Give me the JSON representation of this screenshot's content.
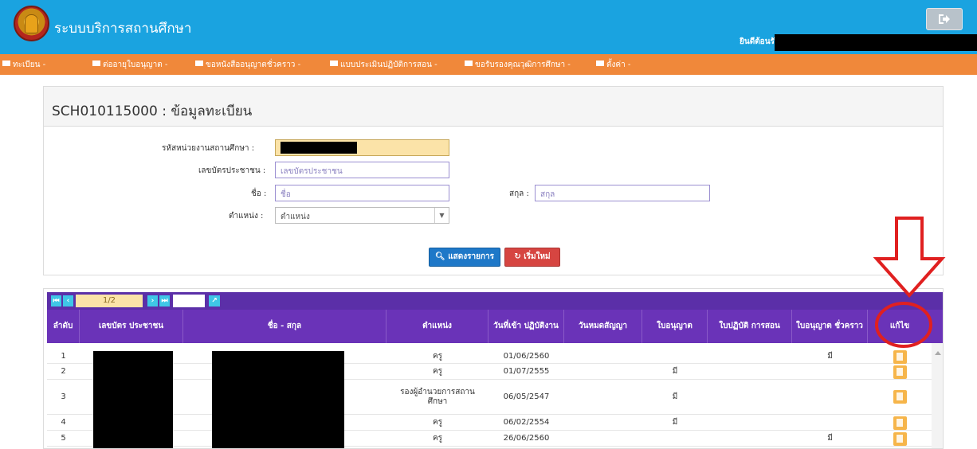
{
  "header": {
    "app_title": "ระบบบริการสถานศึกษา",
    "welcome": "ยินดีต้อนรับ",
    "logout_icon": "sign-out-icon"
  },
  "nav": {
    "items": [
      {
        "label": "ทะเบียน -"
      },
      {
        "label": "ต่ออายุใบอนุญาต -"
      },
      {
        "label": "ขอหนังสืออนุญาตชั่วคราว -"
      },
      {
        "label": "แบบประเมินปฏิบัติการสอน -"
      },
      {
        "label": "ขอรับรองคุณวุฒิการศึกษา -"
      },
      {
        "label": "ตั้งค่า -"
      }
    ]
  },
  "page": {
    "title": "SCH010115000 : ข้อมูลทะเบียน"
  },
  "form": {
    "school_code_label": "รหัสหน่วยงานสถานศึกษา :",
    "id_card_label": "เลขบัตรประชาชน :",
    "id_card_placeholder": "เลขบัตรประชาชน",
    "first_name_label": "ชื่อ :",
    "first_name_placeholder": "ชื่อ",
    "last_name_label": "สกุล :",
    "last_name_placeholder": "สกุล",
    "position_label": "ตำแหน่ง :",
    "position_value": "ตำแหน่ง",
    "search_button": "แสดงรายการ",
    "reset_button": "เริ่มใหม่"
  },
  "pager": {
    "page": "1/2"
  },
  "table": {
    "headers": [
      "ลำดับ",
      "เลขบัตร ประชาชน",
      "ชื่อ - สกุล",
      "ตำแหน่ง",
      "วันที่เข้า ปฏิบัติงาน",
      "วันหมดสัญญา",
      "ใบอนุญาต",
      "ใบปฏิบัติ การสอน",
      "ใบอนุญาต ชั่วคราว",
      "แก้ไข"
    ],
    "rows": [
      {
        "no": "1",
        "position": "ครู",
        "start": "01/06/2560",
        "end": "",
        "license": "",
        "practice": "",
        "temp": "มี"
      },
      {
        "no": "2",
        "position": "ครู",
        "start": "01/07/2555",
        "end": "",
        "license": "มี",
        "practice": "",
        "temp": ""
      },
      {
        "no": "3",
        "position": "รองผู้อำนวยการสถานศึกษา",
        "start": "06/05/2547",
        "end": "",
        "license": "มี",
        "practice": "",
        "temp": ""
      },
      {
        "no": "4",
        "position": "ครู",
        "start": "06/02/2554",
        "end": "",
        "license": "มี",
        "practice": "",
        "temp": ""
      },
      {
        "no": "5",
        "position": "ครู",
        "start": "26/06/2560",
        "end": "",
        "license": "",
        "practice": "",
        "temp": "มี"
      }
    ]
  },
  "colors": {
    "topbar": "#1aa3e0",
    "navbar": "#f0883a",
    "table_header": "#6a33b8",
    "annotation": "#e02020"
  }
}
